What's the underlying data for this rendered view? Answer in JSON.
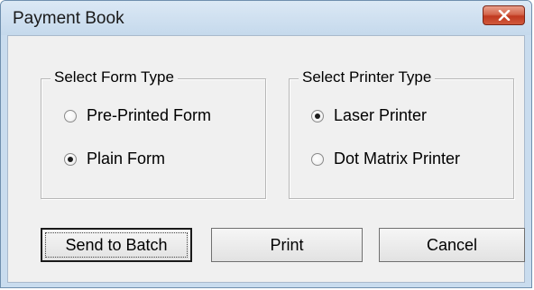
{
  "window": {
    "title": "Payment Book"
  },
  "form_type_group": {
    "legend": "Select Form Type",
    "options": [
      {
        "label": "Pre-Printed Form",
        "selected": false
      },
      {
        "label": "Plain Form",
        "selected": true
      }
    ]
  },
  "printer_type_group": {
    "legend": "Select Printer Type",
    "options": [
      {
        "label": "Laser Printer",
        "selected": true
      },
      {
        "label": "Dot Matrix Printer",
        "selected": false
      }
    ]
  },
  "buttons": {
    "send_to_batch": "Send to Batch",
    "print": "Print",
    "cancel": "Cancel"
  },
  "colors": {
    "window_frame": "#c9dcee",
    "client_bg": "#f0f0f0",
    "close_button": "#c0391f"
  }
}
